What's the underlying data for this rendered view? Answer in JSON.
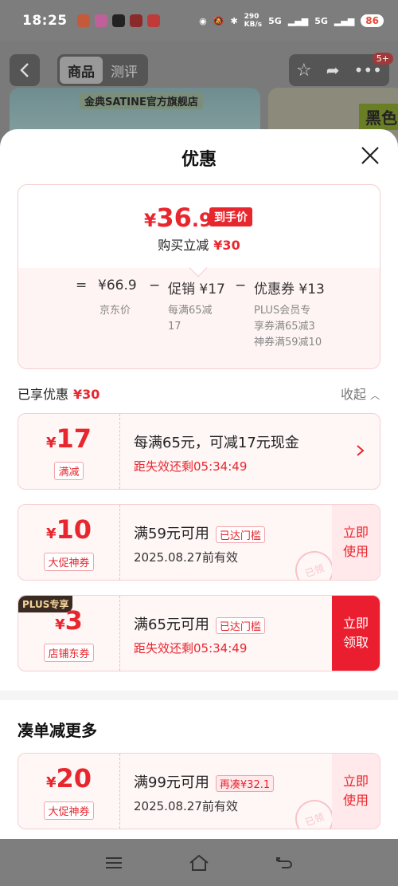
{
  "status": {
    "time": "18:25",
    "speed": "290\nKB/s",
    "net1": "5G",
    "net2": "5G",
    "battery": "86"
  },
  "page": {
    "tab_goods": "商品",
    "tab_review": "测评",
    "store_banner": "金典SATINE官方旗舰店",
    "banner2_text": "黑色",
    "badge": "5+"
  },
  "sheet": {
    "title": "优惠",
    "final_price_yen": "¥",
    "final_price_int": "36",
    "final_price_dec": ".9",
    "final_tag": "到手价",
    "reduce_label": "购买立减",
    "reduce_value": "¥30",
    "formula": {
      "eq": "=",
      "jd_price": "¥66.9",
      "minus1": "−",
      "promo": "促销 ¥17",
      "minus2": "−",
      "coupon": "优惠券 ¥13",
      "jd_label": "京东价",
      "promo_sub": "每满65减\n17",
      "coupon_sub": "PLUS会员专\n享券满65减3\n神券满59减10"
    },
    "enjoyed_label": "已享优惠",
    "enjoyed_value": "¥30",
    "collapse_label": "收起",
    "coupons": [
      {
        "yen": "¥",
        "amount": "17",
        "kind": "满减",
        "line1": "每满65元，可减17元现金",
        "line2": "距失效还剩05:34:49"
      },
      {
        "yen": "¥",
        "amount": "10",
        "kind": "大促神券",
        "line1": "满59元可用",
        "threshold": "已达门槛",
        "line2": "2025.08.27前有效",
        "action": "立即\n使用",
        "stamp": "已领"
      },
      {
        "plus": "PLUS专享",
        "yen": "¥",
        "amount": "3",
        "kind": "店铺东券",
        "line1": "满65元可用",
        "threshold": "已达门槛",
        "line2": "距失效还剩05:34:49",
        "action": "立即\n领取"
      }
    ],
    "more_title": "凑单减更多",
    "more_coupon": {
      "yen": "¥",
      "amount": "20",
      "kind": "大促神券",
      "line1": "满99元可用",
      "threshold": "再凑¥32.1",
      "line2": "2025.08.27前有效",
      "action": "立即\n使用",
      "stamp": "已领"
    }
  }
}
